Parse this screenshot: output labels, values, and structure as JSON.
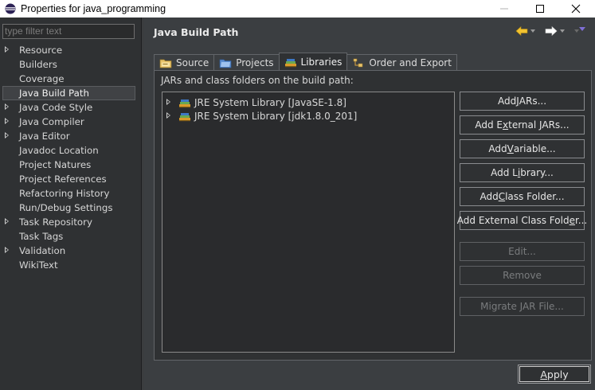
{
  "window": {
    "title": "Properties for java_programming",
    "icon": "eclipse-icon",
    "minimize": "—",
    "maximize": "☐",
    "close": "✕"
  },
  "filter": {
    "placeholder": "type filter text"
  },
  "sidebar": {
    "items": [
      {
        "label": "Resource",
        "expandable": true
      },
      {
        "label": "Builders",
        "expandable": false
      },
      {
        "label": "Coverage",
        "expandable": false
      },
      {
        "label": "Java Build Path",
        "expandable": false,
        "selected": true
      },
      {
        "label": "Java Code Style",
        "expandable": true
      },
      {
        "label": "Java Compiler",
        "expandable": true
      },
      {
        "label": "Java Editor",
        "expandable": true
      },
      {
        "label": "Javadoc Location",
        "expandable": false
      },
      {
        "label": "Project Natures",
        "expandable": false
      },
      {
        "label": "Project References",
        "expandable": false
      },
      {
        "label": "Refactoring History",
        "expandable": false
      },
      {
        "label": "Run/Debug Settings",
        "expandable": false
      },
      {
        "label": "Task Repository",
        "expandable": true
      },
      {
        "label": "Task Tags",
        "expandable": false
      },
      {
        "label": "Validation",
        "expandable": true
      },
      {
        "label": "WikiText",
        "expandable": false
      }
    ]
  },
  "page": {
    "title": "Java Build Path",
    "nav_back_icon": "back-arrow-icon",
    "nav_forward_icon": "forward-arrow-icon"
  },
  "tabs": [
    {
      "label": "Source",
      "icon": "source-folder-icon"
    },
    {
      "label": "Projects",
      "icon": "projects-icon"
    },
    {
      "label": "Libraries",
      "icon": "libraries-icon",
      "active": true
    },
    {
      "label": "Order and Export",
      "icon": "order-export-icon"
    }
  ],
  "libraries": {
    "description": "JARs and class folders on the build path:",
    "items": [
      {
        "label": "JRE System Library [JavaSE-1.8]"
      },
      {
        "label": "JRE System Library [jdk1.8.0_201]"
      }
    ]
  },
  "buttons": {
    "add_jars": {
      "pre": "Add ",
      "mn": "J",
      "post": "ARs..."
    },
    "add_external_jars": {
      "pre": "Add E",
      "mn": "x",
      "post": "ternal JARs..."
    },
    "add_variable": {
      "pre": "Add ",
      "mn": "V",
      "post": "ariable..."
    },
    "add_library": {
      "pre": "Add L",
      "mn": "i",
      "post": "brary..."
    },
    "add_class_folder": {
      "pre": "Add ",
      "mn": "C",
      "post": "lass Folder..."
    },
    "add_external_class_folder": {
      "pre": "Add External Class Fold",
      "mn": "e",
      "post": "r..."
    },
    "edit": "Edit...",
    "remove": "Remove",
    "migrate": "Migrate JAR File...",
    "apply": {
      "pre": "",
      "mn": "A",
      "post": "pply"
    }
  }
}
